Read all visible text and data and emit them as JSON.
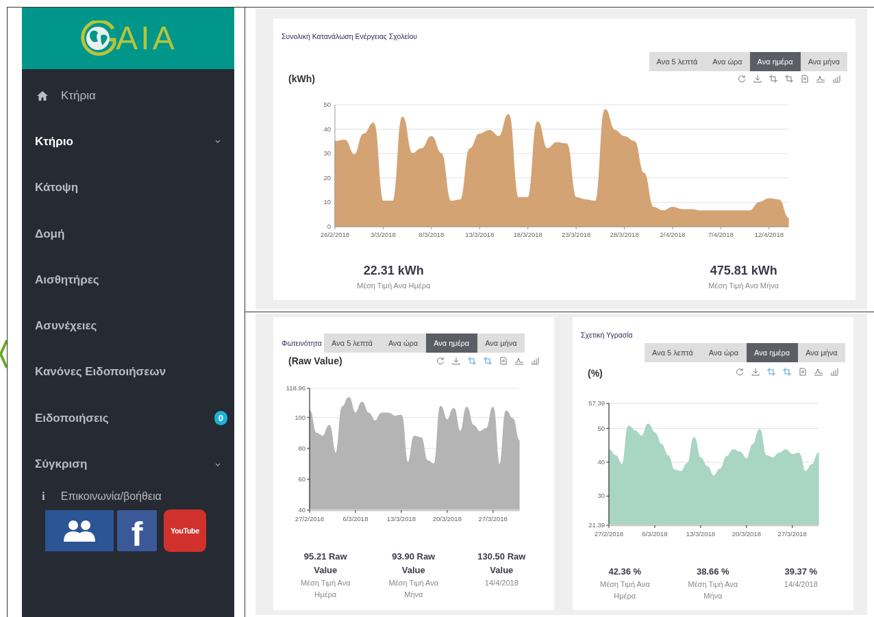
{
  "sidebar": {
    "logo": "AIA",
    "items": [
      {
        "label": "Κτήρια",
        "kind": "home",
        "selected": false,
        "has_submenu": false
      },
      {
        "label": "Κτήριο",
        "kind": "plain",
        "selected": true,
        "has_submenu": true
      },
      {
        "label": "Κάτοψη",
        "kind": "plain",
        "selected": false,
        "has_submenu": false
      },
      {
        "label": "Δομή",
        "kind": "plain",
        "selected": false,
        "has_submenu": false
      },
      {
        "label": "Αισθητήρες",
        "kind": "plain",
        "selected": false,
        "has_submenu": false
      },
      {
        "label": "Ασυνέχειες",
        "kind": "plain",
        "selected": false,
        "has_submenu": false
      },
      {
        "label": "Κανόνες Ειδοποιήσεων",
        "kind": "plain",
        "selected": false,
        "has_submenu": false
      },
      {
        "label": "Ειδοποιήσεις",
        "kind": "plain",
        "selected": false,
        "has_submenu": false,
        "badge": "0"
      },
      {
        "label": "Σύγκριση",
        "kind": "plain",
        "selected": false,
        "has_submenu": true
      }
    ],
    "help": {
      "label": "Επικοινωνία/βοήθεια",
      "icon_text": "i"
    },
    "social": [
      {
        "kind": "people"
      },
      {
        "kind": "facebook",
        "text": "f"
      },
      {
        "kind": "youtube",
        "text": "YouTube"
      }
    ]
  },
  "cards": [
    {
      "title": "Συνολική Κατανάλωση Ενέργειας Σχολείου",
      "kind": "wide",
      "periods": [
        {
          "label": "Ανα 5 λεπτά",
          "selected": false
        },
        {
          "label": "Ανα ώρα",
          "selected": false
        },
        {
          "label": "Ανα ημέρα",
          "selected": true
        },
        {
          "label": "Ανα μήνα",
          "selected": false
        }
      ],
      "toolbar": [
        {
          "kind": "refresh",
          "active": false
        },
        {
          "kind": "download",
          "active": false
        },
        {
          "kind": "crop",
          "active": false
        },
        {
          "kind": "crop",
          "active": false
        },
        {
          "kind": "document",
          "active": false
        },
        {
          "kind": "line",
          "active": false
        },
        {
          "kind": "bars",
          "active": false
        }
      ],
      "chart_data": {
        "type": "area",
        "ylabel": "(kWh)",
        "grid": true,
        "ylim": [
          0,
          50
        ],
        "yticks": [
          0,
          10,
          20,
          30,
          40,
          50
        ],
        "categories": [
          "26/2/2018",
          null,
          null,
          null,
          null,
          "3/3/2018",
          null,
          null,
          null,
          null,
          "8/3/2018",
          null,
          null,
          null,
          null,
          "13/3/2018",
          null,
          null,
          null,
          null,
          "18/3/2018",
          null,
          null,
          null,
          null,
          "23/3/2018",
          null,
          null,
          null,
          null,
          "28/3/2018",
          null,
          null,
          null,
          null,
          "2/4/2018",
          null,
          null,
          null,
          null,
          "7/4/2018",
          null,
          null,
          null,
          null,
          "12/4/2018",
          null,
          null
        ],
        "series": [
          {
            "color": "#d3a373",
            "values": [
              35,
              35.5,
              29.5,
              38,
              42.5,
              10.5,
              10.5,
              45,
              30,
              32,
              37,
              30,
              10.5,
              11,
              32,
              38,
              39.5,
              37,
              46,
              12,
              12,
              43,
              32,
              34.5,
              34,
              12,
              11,
              10.5,
              48,
              39.5,
              37,
              35,
              22,
              8,
              6.5,
              8,
              7,
              7,
              6.5,
              6.5,
              6.5,
              6.5,
              6.5,
              6.5,
              10,
              11.5,
              11,
              3.5
            ]
          }
        ]
      },
      "stats": [
        {
          "value": "22.31 kWh",
          "caption": "Μέση Τιμή Ανα Ημέρα"
        },
        {
          "value": "475.81 kWh",
          "caption": "Μέση Τιμή Ανα Μήνα"
        }
      ]
    },
    {
      "title": "Φωτεινότητα",
      "kind": "inline",
      "periods": [
        {
          "label": "Ανα 5 λεπτά",
          "selected": false
        },
        {
          "label": "Ανα ώρα",
          "selected": false
        },
        {
          "label": "Ανα ημέρα",
          "selected": true
        },
        {
          "label": "Ανα μήνα",
          "selected": false
        }
      ],
      "toolbar": [
        {
          "kind": "refresh",
          "active": false
        },
        {
          "kind": "download",
          "active": false
        },
        {
          "kind": "crop",
          "active": true
        },
        {
          "kind": "crop",
          "active": true
        },
        {
          "kind": "document",
          "active": false
        },
        {
          "kind": "line",
          "active": false
        },
        {
          "kind": "bars",
          "active": false
        }
      ],
      "chart_data": {
        "type": "area",
        "ylabel": "(Raw Value)",
        "grid": true,
        "ylim": [
          40,
          118.96
        ],
        "yticks": [
          40,
          60,
          80,
          100,
          118.96
        ],
        "categories": [
          "27/2/2018",
          null,
          null,
          null,
          null,
          null,
          null,
          "6/3/2018",
          null,
          null,
          null,
          null,
          null,
          null,
          "13/3/2018",
          null,
          null,
          null,
          null,
          null,
          null,
          "20/3/2018",
          null,
          null,
          null,
          null,
          null,
          null,
          "27/3/2018",
          null,
          null,
          null,
          null
        ],
        "series": [
          {
            "color": "#b4b4b4",
            "values": [
              104.4,
              90,
              88,
              95,
              77,
              107,
              113,
              103,
              110,
              103,
              98,
              103,
              103,
              101,
              101.5,
              71,
              88,
              87,
              72,
              70,
              107.4,
              98.5,
              106,
              91,
              106.7,
              95,
              91,
              93,
              106.7,
              69.6,
              104.4,
              99.3,
              85
            ]
          }
        ]
      },
      "stats": [
        {
          "value": "95.21 Raw Value",
          "caption": "Μέση Τιμή Ανα Ημέρα"
        },
        {
          "value": "93.90 Raw Value",
          "caption": "Μέση Τιμή Ανα Μήνα"
        },
        {
          "value": "130.50 Raw Value",
          "caption": "14/4/2018"
        }
      ]
    },
    {
      "title": "Σχετική Υγρασία",
      "kind": "stacked",
      "periods": [
        {
          "label": "Ανα 5 λεπτά",
          "selected": false
        },
        {
          "label": "Ανα ώρα",
          "selected": false
        },
        {
          "label": "Ανα ημέρα",
          "selected": true
        },
        {
          "label": "Ανα μήνα",
          "selected": false
        }
      ],
      "toolbar": [
        {
          "kind": "refresh",
          "active": false
        },
        {
          "kind": "download",
          "active": false
        },
        {
          "kind": "crop",
          "active": true
        },
        {
          "kind": "crop",
          "active": true
        },
        {
          "kind": "document",
          "active": false
        },
        {
          "kind": "line",
          "active": false
        },
        {
          "kind": "bars",
          "active": false
        }
      ],
      "chart_data": {
        "type": "area",
        "ylabel": "(%)",
        "grid": true,
        "ylim": [
          21.39,
          57.39
        ],
        "yticks": [
          21.39,
          30,
          40,
          50,
          57.39
        ],
        "categories": [
          "27/2/2018",
          null,
          null,
          null,
          null,
          null,
          null,
          "6/3/2018",
          null,
          null,
          null,
          null,
          null,
          null,
          "13/3/2018",
          null,
          null,
          null,
          null,
          null,
          null,
          "20/3/2018",
          null,
          null,
          null,
          null,
          null,
          null,
          "27/3/2018",
          null,
          null,
          null,
          null
        ],
        "series": [
          {
            "color": "#a9d5c4",
            "values": [
              43.7,
              42,
              39.3,
              50.7,
              49.3,
              47.7,
              51.3,
              48.7,
              45.3,
              42,
              37.7,
              37.3,
              39.7,
              47.3,
              41.3,
              38.7,
              36,
              38,
              41.7,
              43.7,
              43,
              41,
              45.3,
              49.7,
              42,
              41.3,
              42.7,
              43.7,
              42.3,
              42.7,
              37.3,
              39.3,
              42.7
            ]
          }
        ]
      },
      "stats": [
        {
          "value": "42.36 %",
          "caption": "Μέση Τιμή Ανα Ημέρα"
        },
        {
          "value": "38.66 %",
          "caption": "Μέση Τιμή Ανα Μήνα"
        },
        {
          "value": "39.37 %",
          "caption": "14/4/2018"
        }
      ]
    }
  ]
}
